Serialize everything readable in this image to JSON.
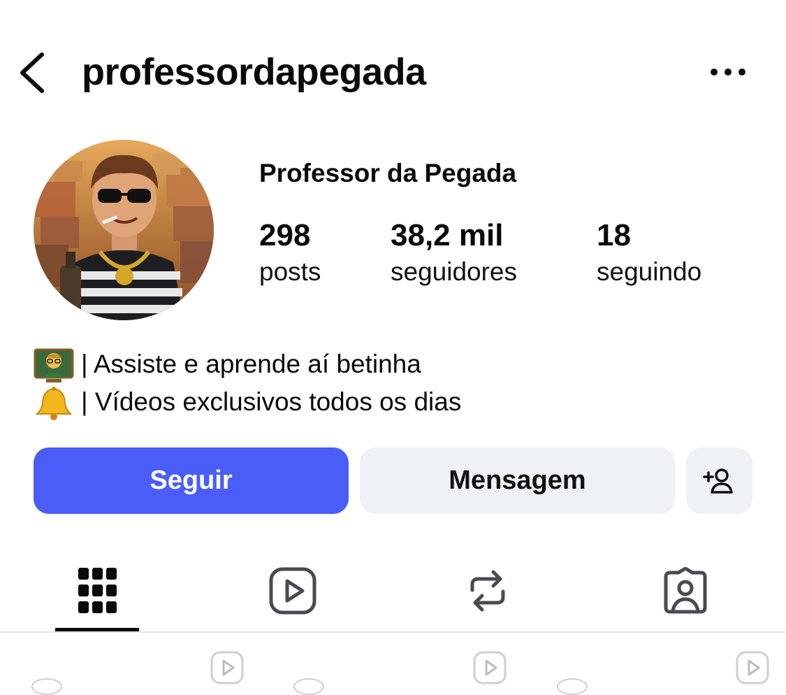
{
  "header": {
    "username": "professordapegada"
  },
  "profile": {
    "display_name": "Professor da Pegada",
    "stats": [
      {
        "value": "298",
        "label": "posts"
      },
      {
        "value": "38,2 mil",
        "label": "seguidores"
      },
      {
        "value": "18",
        "label": "seguindo"
      }
    ],
    "bio": [
      {
        "icon": "teacher-emoji-icon",
        "text": "| Assiste e aprende aí betinha"
      },
      {
        "icon": "bell-emoji-icon",
        "text": "| Vídeos exclusivos todos os dias"
      }
    ]
  },
  "actions": {
    "follow_label": "Seguir",
    "message_label": "Mensagem"
  },
  "tabs": [
    {
      "icon": "grid-icon",
      "active": true
    },
    {
      "icon": "reels-icon",
      "active": false
    },
    {
      "icon": "reposts-icon",
      "active": false
    },
    {
      "icon": "tagged-icon",
      "active": false
    }
  ],
  "colors": {
    "accent": "#4a5df9",
    "secondary_button": "#eef1f5",
    "text": "#0a0a0a"
  }
}
